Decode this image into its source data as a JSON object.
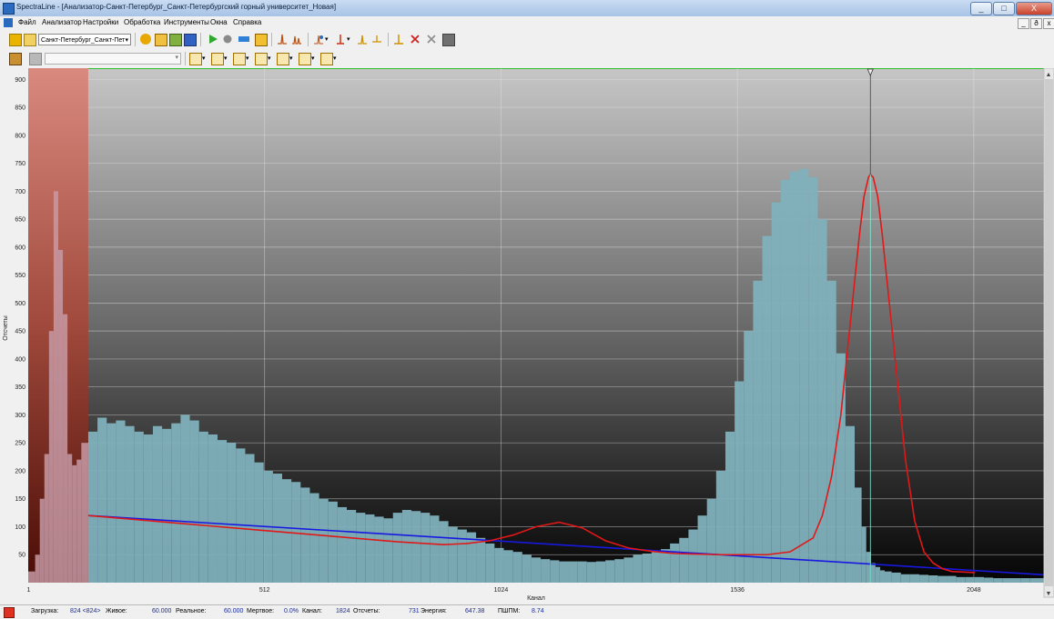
{
  "window": {
    "title": "SpectraLine - [Анализатор-Санкт-Петербург_Санкт-Петербургский горный университет_Новая]",
    "controls": [
      "_",
      "□",
      "X"
    ],
    "mdi_controls": [
      "_",
      "ð",
      "x"
    ]
  },
  "menu": {
    "items": [
      "Файл",
      "Анализатор",
      "Настройки",
      "Обработка",
      "Инструменты",
      "Окна",
      "Справка"
    ]
  },
  "toolbar": {
    "analyzer_select": "Санкт-Петербург_Санкт-Пет",
    "filter_value": ""
  },
  "colors": {
    "roi": "#d9897e",
    "histogram": "#7fb1bc",
    "fit_curve": "#e01818",
    "baseline": "#1818e0",
    "marker": "#444444"
  },
  "chart_data": {
    "type": "bar",
    "xlabel": "Канал",
    "ylabel": "Отсчеты",
    "xlim": [
      0,
      2200
    ],
    "ylim": [
      0,
      920
    ],
    "x_ticks": [
      1,
      512,
      1024,
      1536,
      2048
    ],
    "y_ticks": [
      50,
      100,
      150,
      200,
      250,
      300,
      350,
      400,
      450,
      500,
      550,
      600,
      650,
      700,
      750,
      800,
      850,
      900
    ],
    "grid": true,
    "roi": [
      0,
      130
    ],
    "marker_channel": 1824,
    "hist_x": [
      10,
      20,
      30,
      40,
      50,
      60,
      70,
      80,
      90,
      100,
      110,
      120,
      140,
      160,
      180,
      200,
      220,
      240,
      260,
      280,
      300,
      320,
      340,
      360,
      380,
      400,
      420,
      440,
      460,
      480,
      500,
      520,
      540,
      560,
      580,
      600,
      620,
      640,
      660,
      680,
      700,
      720,
      740,
      760,
      780,
      800,
      820,
      840,
      860,
      880,
      900,
      920,
      940,
      960,
      980,
      1000,
      1020,
      1040,
      1060,
      1080,
      1100,
      1120,
      1140,
      1160,
      1180,
      1200,
      1220,
      1240,
      1260,
      1280,
      1300,
      1320,
      1340,
      1360,
      1380,
      1400,
      1420,
      1440,
      1460,
      1480,
      1500,
      1520,
      1540,
      1560,
      1580,
      1600,
      1620,
      1640,
      1660,
      1680,
      1700,
      1720,
      1740,
      1760,
      1780,
      1800,
      1810,
      1820,
      1830,
      1840,
      1850,
      1860,
      1880,
      1900,
      1920,
      1940,
      1960,
      1980,
      2000,
      2020,
      2040,
      2060,
      2080,
      2100,
      2120,
      2140,
      2160,
      2180
    ],
    "hist_y": [
      20,
      50,
      150,
      230,
      450,
      700,
      595,
      480,
      230,
      210,
      220,
      250,
      270,
      295,
      285,
      290,
      280,
      270,
      265,
      280,
      275,
      285,
      300,
      290,
      270,
      265,
      255,
      250,
      240,
      230,
      215,
      200,
      195,
      185,
      180,
      170,
      160,
      150,
      145,
      135,
      130,
      125,
      122,
      118,
      115,
      125,
      130,
      128,
      125,
      120,
      110,
      100,
      95,
      90,
      80,
      70,
      62,
      58,
      55,
      50,
      45,
      42,
      40,
      38,
      38,
      38,
      37,
      38,
      40,
      42,
      45,
      50,
      52,
      55,
      60,
      70,
      80,
      95,
      120,
      150,
      200,
      270,
      360,
      450,
      540,
      620,
      680,
      720,
      735,
      740,
      725,
      650,
      540,
      410,
      280,
      170,
      100,
      55,
      35,
      28,
      22,
      20,
      18,
      15,
      15,
      14,
      13,
      12,
      12,
      10,
      10,
      10,
      9,
      8,
      8,
      8,
      8,
      8
    ],
    "fit_x": [
      130,
      200,
      300,
      400,
      500,
      600,
      700,
      800,
      900,
      950,
      1000,
      1050,
      1100,
      1150,
      1200,
      1250,
      1300,
      1350,
      1400,
      1450,
      1500,
      1550,
      1600,
      1650,
      1700,
      1720,
      1740,
      1760,
      1780,
      1800,
      1810,
      1820,
      1824,
      1830,
      1840,
      1850,
      1860,
      1880,
      1900,
      1920,
      1940,
      1960,
      1980,
      2000,
      2050
    ],
    "fit_y": [
      120,
      115,
      108,
      101,
      94,
      87,
      80,
      73,
      68,
      70,
      75,
      85,
      100,
      108,
      98,
      75,
      62,
      56,
      52,
      51,
      50,
      50,
      50,
      55,
      80,
      120,
      190,
      300,
      460,
      620,
      690,
      725,
      730,
      725,
      690,
      620,
      540,
      380,
      220,
      110,
      55,
      35,
      25,
      20,
      18
    ],
    "base_x": [
      130,
      2200
    ],
    "base_y": [
      120,
      14
    ]
  },
  "status": {
    "load_label": "Загрузка:",
    "load_value": "824 <824>",
    "live_label": "Живое:",
    "live_value": "60.000",
    "real_label": "Реальное:",
    "real_value": "60.000",
    "dead_label": "Мертвое:",
    "dead_value": "0.0%",
    "channel_label": "Канал:",
    "channel_value": "1824",
    "counts_label": "Отсчеты:",
    "counts_value": "731",
    "energy_label": "Энергия:",
    "energy_value": "647.38",
    "fwhm_label": "ПШПМ:",
    "fwhm_value": "8.74"
  }
}
